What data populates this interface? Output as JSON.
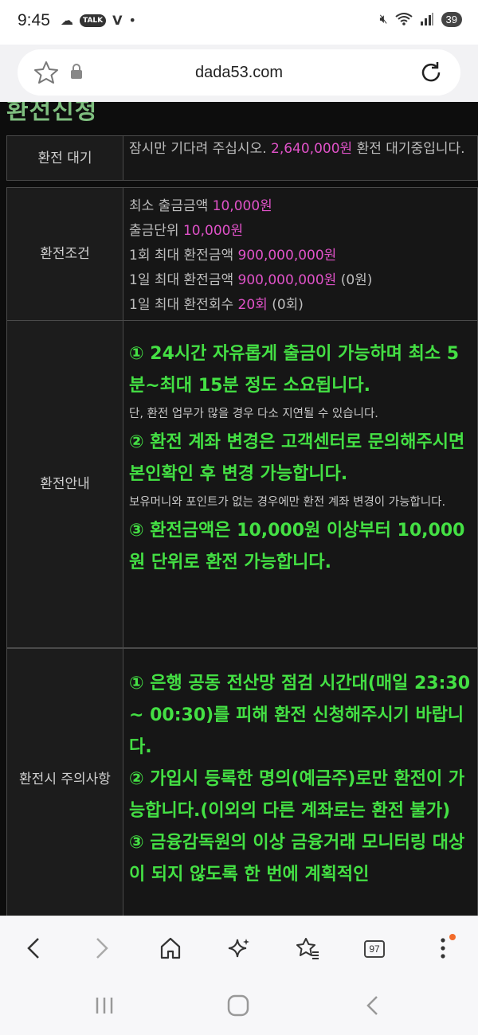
{
  "status": {
    "time": "9:45",
    "talk_badge": "TALK",
    "battery": "39"
  },
  "browser": {
    "url": "dada53.com",
    "tab_count": "97"
  },
  "page": {
    "title": "환전신청",
    "rows": {
      "wait": {
        "label": "환전 대기",
        "prefix": "잠시만 기다려 주십시오. ",
        "amount": "2,640,000원",
        "suffix": " 환전 대기중입니다."
      },
      "conditions": {
        "label": "환전조건",
        "lines": [
          {
            "text": "최소 출금금액 ",
            "value": "10,000원",
            "extra": ""
          },
          {
            "text": "출금단위 ",
            "value": "10,000원",
            "extra": ""
          },
          {
            "text": "1회 최대 환전금액 ",
            "value": "900,000,000원",
            "extra": ""
          },
          {
            "text": "1일 최대 환전금액 ",
            "value": "900,000,000원",
            "extra": " (0원)"
          },
          {
            "text": "1일 최대 환전회수 ",
            "value": "20회",
            "extra": " (0회)"
          }
        ]
      },
      "guide": {
        "label": "환전안내",
        "item1": "① 24시간 자유롭게 출금이 가능하며 최소 5분~최대 15분 정도 소요됩니다.",
        "note1": "단, 환전 업무가 많을 경우 다소 지연될 수 있습니다.",
        "item2": "② 환전 계좌 변경은 고객센터로 문의해주시면 본인확인 후 변경 가능합니다.",
        "note2": "보유머니와 포인트가 없는 경우에만 환전 계좌 변경이 가능합니다.",
        "item3": "③ 환전금액은 10,000원 이상부터 10,000원 단위로 환전 가능합니다."
      },
      "caution": {
        "label": "환전시 주의사항",
        "item1": "① 은행 공동 전산망 점검 시간대(매일 23:30 ~ 00:30)를 피해 환전 신청해주시기 바랍니다.",
        "item2": "② 가입시 등록한 명의(예금주)로만 환전이 가능합니다.(이외의 다른 계좌로는 환전 불가)",
        "item3": "③ 금융감독원의 이상 금융거래 모니터링 대상이 되지 않도록 한 번에 계획적인"
      }
    }
  },
  "colors": {
    "highlight": "#e052c8",
    "notice_green": "#44e044",
    "page_bg": "#0d0d0d"
  }
}
